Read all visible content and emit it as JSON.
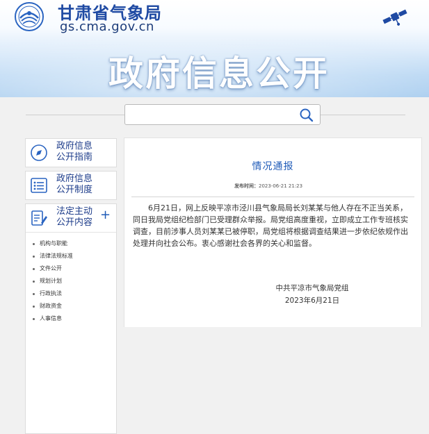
{
  "header": {
    "site_name": "甘肃省气象局",
    "site_url": "gs.cma.gov.cn",
    "page_title": "政府信息公开"
  },
  "search": {
    "placeholder": "",
    "value": ""
  },
  "sidebar": {
    "items": [
      {
        "label": "政府信息公开指南",
        "icon": "compass-icon"
      },
      {
        "label": "政府信息公开制度",
        "icon": "list-icon"
      },
      {
        "label": "法定主动公开内容",
        "icon": "document-edit-icon",
        "expand": "+"
      }
    ],
    "sub_items": [
      "机构与职能",
      "法律法规标准",
      "文件公开",
      "规划计划",
      "行政执法",
      "财政资金",
      "人事信息"
    ]
  },
  "article": {
    "title": "情况通报",
    "publish_label": "发布时间：",
    "publish_time": "2023-06-21 21:23",
    "body": "6月21日，网上反映平凉市泾川县气象局局长刘某某与他人存在不正当关系，同日我局党组纪检部门已受理群众举报。局党组高度重视，立即成立工作专班核实调查，目前涉事人员刘某某已被停职，局党组将根据调查结果进一步依纪依规作出处理并向社会公布。衷心感谢社会各界的关心和监督。",
    "signature_org": "中共平凉市气象局党组",
    "signature_date": "2023年6月21日"
  },
  "colors": {
    "brand_blue": "#1f4aa3",
    "link_blue": "#1f5bb8",
    "header_sky": "#a9cdef"
  }
}
